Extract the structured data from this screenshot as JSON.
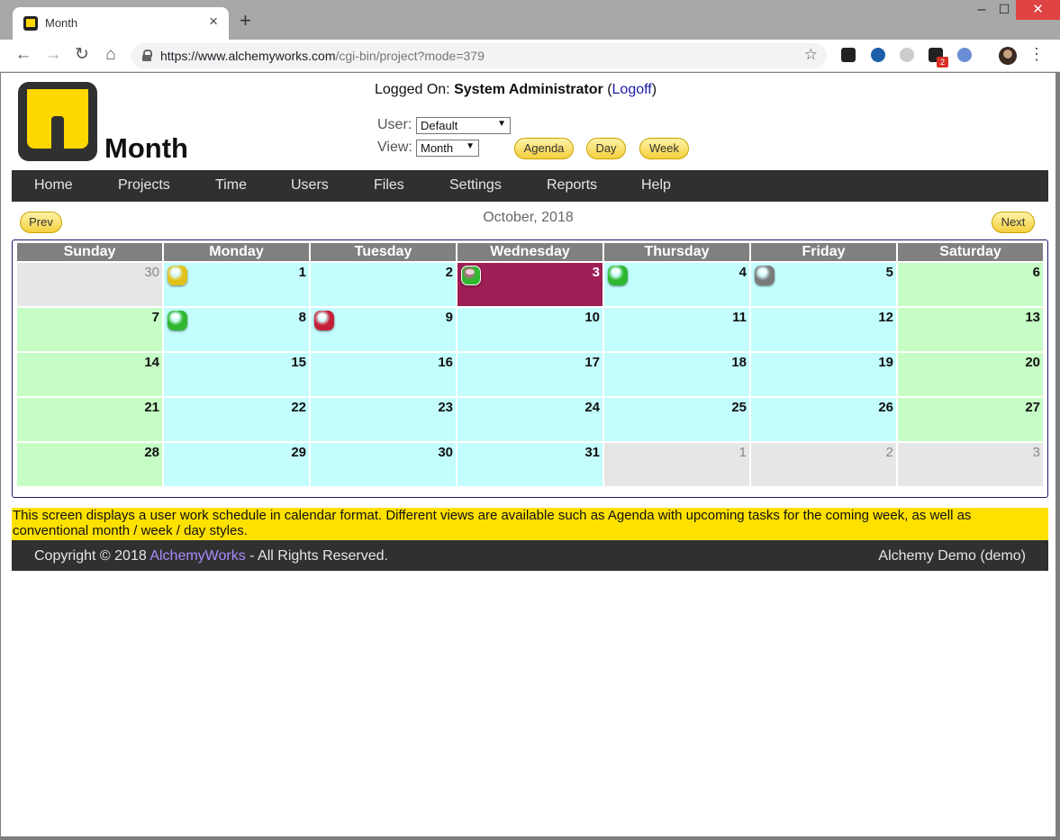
{
  "browser": {
    "tab_title": "Month",
    "url_host": "https://www.alchemyworks.com",
    "url_path": "/cgi-bin/project?mode=379",
    "extension_badge": "2"
  },
  "header": {
    "page_title": "Month",
    "logged_on_label": "Logged On:",
    "user_name": "System Administrator",
    "logoff_label": "Logoff",
    "user_label": "User:",
    "user_value": "Default",
    "view_label": "View:",
    "view_value": "Month",
    "agenda_label": "Agenda",
    "day_label": "Day",
    "week_label": "Week"
  },
  "nav": [
    "Home",
    "Projects",
    "Time",
    "Users",
    "Files",
    "Settings",
    "Reports",
    "Help"
  ],
  "calendar": {
    "month_label": "October, 2018",
    "prev_label": "Prev",
    "next_label": "Next",
    "days": [
      "Sunday",
      "Monday",
      "Tuesday",
      "Wednesday",
      "Thursday",
      "Friday",
      "Saturday"
    ],
    "weeks": [
      [
        {
          "d": "30",
          "t": "other"
        },
        {
          "d": "1",
          "t": "weekday",
          "gem": "yellow"
        },
        {
          "d": "2",
          "t": "weekday"
        },
        {
          "d": "3",
          "t": "today",
          "gem": "green"
        },
        {
          "d": "4",
          "t": "weekday",
          "gem": "green"
        },
        {
          "d": "5",
          "t": "weekday",
          "gem": "gray"
        },
        {
          "d": "6",
          "t": "weekend"
        }
      ],
      [
        {
          "d": "7",
          "t": "weekend"
        },
        {
          "d": "8",
          "t": "weekday",
          "gem": "green"
        },
        {
          "d": "9",
          "t": "weekday",
          "gem": "red"
        },
        {
          "d": "10",
          "t": "weekday"
        },
        {
          "d": "11",
          "t": "weekday"
        },
        {
          "d": "12",
          "t": "weekday"
        },
        {
          "d": "13",
          "t": "weekend"
        }
      ],
      [
        {
          "d": "14",
          "t": "weekend"
        },
        {
          "d": "15",
          "t": "weekday"
        },
        {
          "d": "16",
          "t": "weekday"
        },
        {
          "d": "17",
          "t": "weekday"
        },
        {
          "d": "18",
          "t": "weekday"
        },
        {
          "d": "19",
          "t": "weekday"
        },
        {
          "d": "20",
          "t": "weekend"
        }
      ],
      [
        {
          "d": "21",
          "t": "weekend"
        },
        {
          "d": "22",
          "t": "weekday"
        },
        {
          "d": "23",
          "t": "weekday"
        },
        {
          "d": "24",
          "t": "weekday"
        },
        {
          "d": "25",
          "t": "weekday"
        },
        {
          "d": "26",
          "t": "weekday"
        },
        {
          "d": "27",
          "t": "weekend"
        }
      ],
      [
        {
          "d": "28",
          "t": "weekend"
        },
        {
          "d": "29",
          "t": "weekday"
        },
        {
          "d": "30",
          "t": "weekday"
        },
        {
          "d": "31",
          "t": "weekday"
        },
        {
          "d": "1",
          "t": "other"
        },
        {
          "d": "2",
          "t": "other"
        },
        {
          "d": "3",
          "t": "other"
        }
      ]
    ],
    "gem_colors": {
      "yellow": "#e2c21a",
      "green": "#2fb82f",
      "gray": "#7a7a7a",
      "red": "#c4203a"
    }
  },
  "info_text": "This screen displays a user work schedule in calendar format. Different views are available such as Agenda with upcoming tasks for the coming week, as well as conventional month / week / day styles.",
  "footer": {
    "copyright_prefix": "Copyright © 2018 ",
    "company": "AlchemyWorks",
    "copyright_suffix": " - All Rights Reserved.",
    "instance": "Alchemy Demo (demo)"
  }
}
